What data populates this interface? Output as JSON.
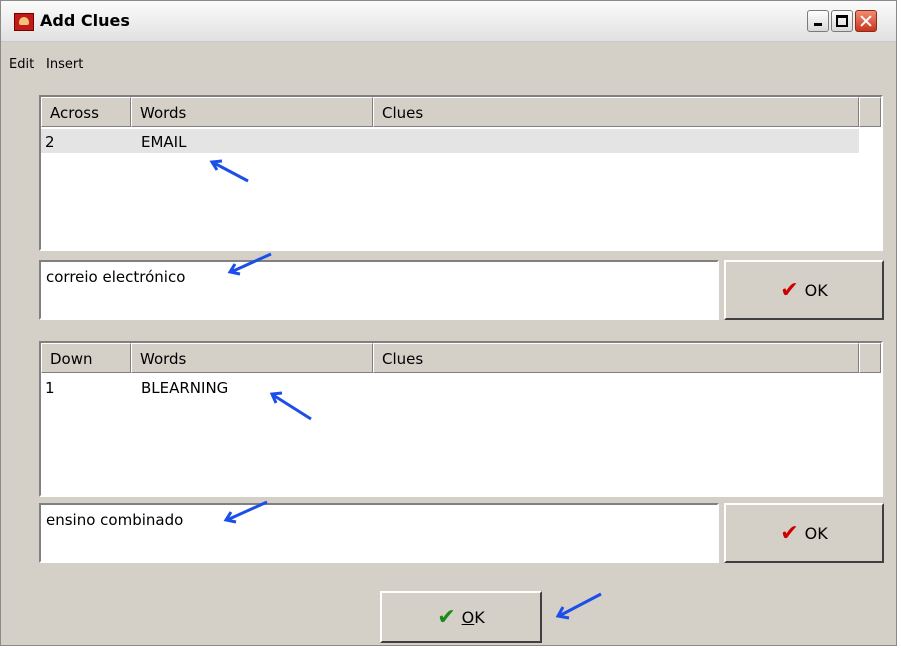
{
  "window": {
    "title": "Add Clues"
  },
  "menu": {
    "items": [
      "Edit",
      "Insert"
    ]
  },
  "across": {
    "columns": [
      "Across",
      "Words",
      "Clues"
    ],
    "rows": [
      {
        "number": "2",
        "word": "EMAIL",
        "clue": ""
      }
    ],
    "clue_text": "correio electrónico",
    "ok_label": "OK"
  },
  "down": {
    "columns": [
      "Down",
      "Words",
      "Clues"
    ],
    "rows": [
      {
        "number": "1",
        "word": "BLEARNING",
        "clue": ""
      }
    ],
    "clue_text": "ensino combinado",
    "ok_label": "OK"
  },
  "footer": {
    "ok_label": "OK",
    "ok_accel": "O"
  },
  "colors": {
    "annotation_arrow": "#1c4ee8",
    "check_red": "#cc0000",
    "check_green": "#1a8a1a"
  }
}
